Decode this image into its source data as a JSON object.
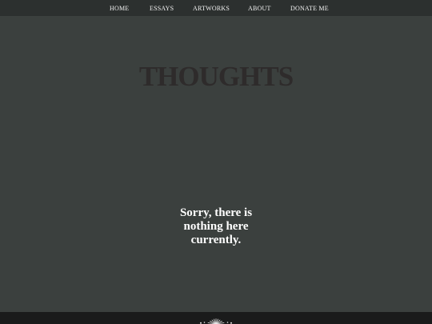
{
  "nav": {
    "items": [
      {
        "label": "HOME"
      },
      {
        "label": "ESSAYS"
      },
      {
        "label": "ARTWORKS"
      },
      {
        "label": "ABOUT"
      },
      {
        "label": "DONATE ME"
      }
    ]
  },
  "main": {
    "title": "THOUGHTS",
    "empty_message": "Sorry, there is nothing here currently."
  },
  "footer": {
    "emblem_icon": "sunburst-logo-icon"
  },
  "colors": {
    "background": "#3b403e",
    "nav_background": "#2c302f",
    "title": "#2e2b2b",
    "message": "#ffffff",
    "footer": "#1a1b1b"
  }
}
